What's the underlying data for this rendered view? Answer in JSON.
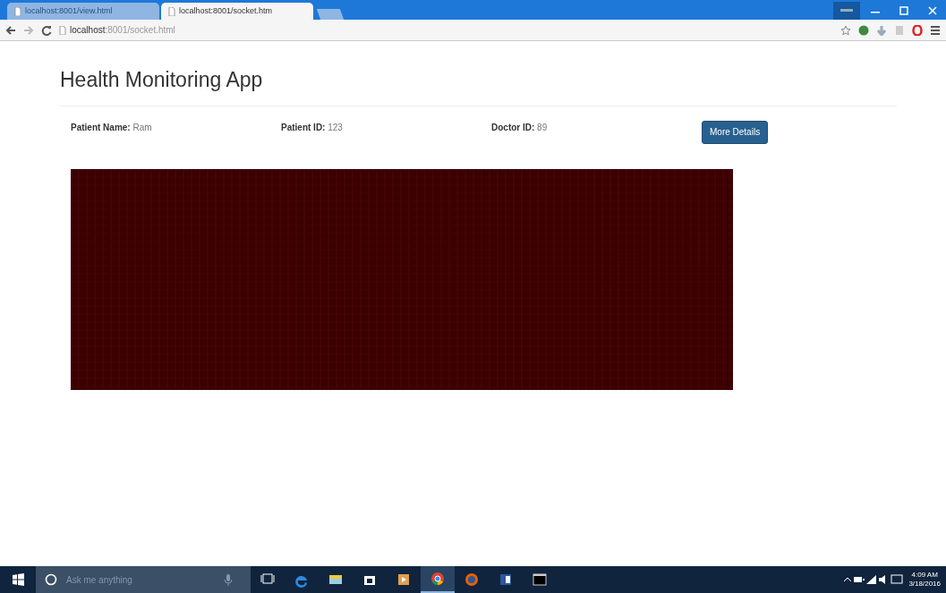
{
  "browser": {
    "tabs": [
      {
        "title": "localhost:8001/view.html",
        "selected": false
      },
      {
        "title": "localhost:8001/socket.htm",
        "selected": true
      }
    ],
    "address": {
      "host": "localhost",
      "rest": ":8001/socket.html"
    }
  },
  "page": {
    "title": "Health Monitoring App",
    "fields": [
      {
        "label": "Patient Name:",
        "value": "Ram"
      },
      {
        "label": "Patient ID:",
        "value": "123"
      },
      {
        "label": "Doctor ID:",
        "value": "89"
      }
    ],
    "button": "More Details"
  },
  "taskbar": {
    "search": {
      "placeholder": "Ask me anything"
    },
    "apps": [
      {
        "kind": "taskview",
        "active": false
      },
      {
        "kind": "edge",
        "active": false
      },
      {
        "kind": "explorer",
        "active": false
      },
      {
        "kind": "store",
        "active": false
      },
      {
        "kind": "media",
        "active": false
      },
      {
        "kind": "chrome",
        "active": true
      },
      {
        "kind": "firefox",
        "active": false
      },
      {
        "kind": "word",
        "active": false
      },
      {
        "kind": "terminal",
        "active": false
      }
    ],
    "clock": {
      "time": "4:09 AM",
      "date": "3/18/2016"
    }
  }
}
